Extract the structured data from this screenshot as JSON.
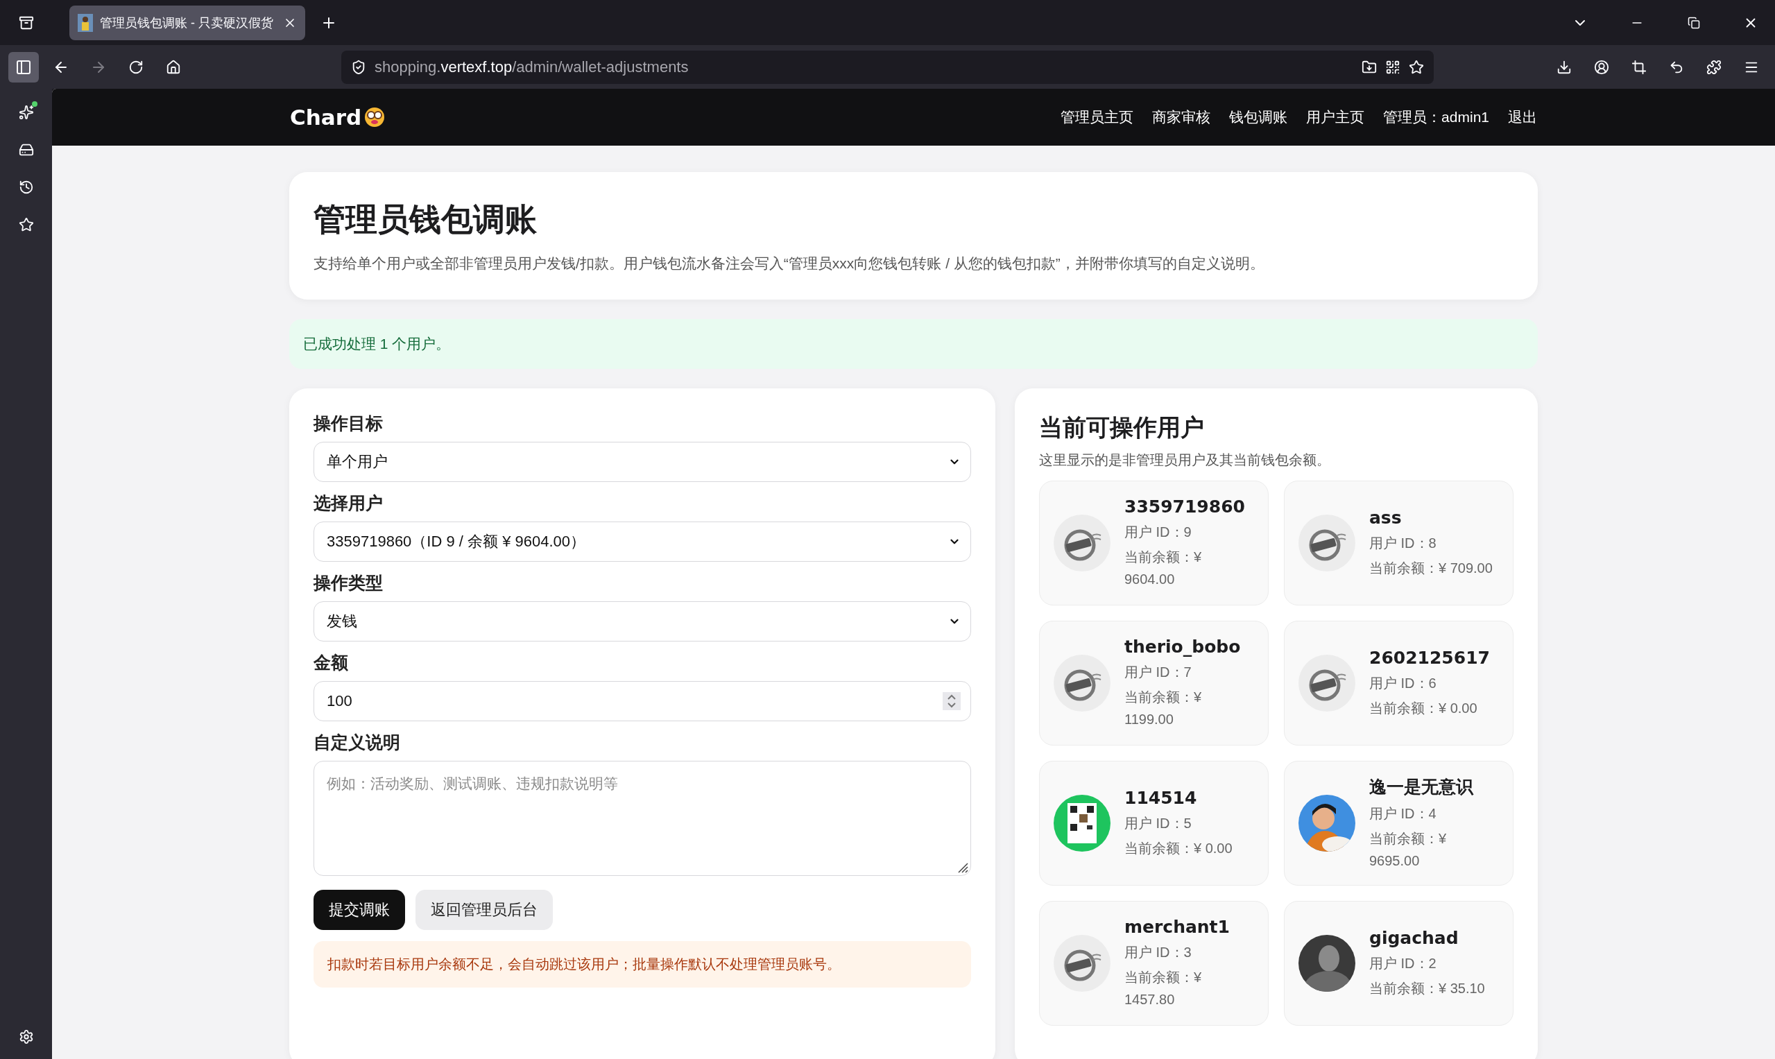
{
  "browser": {
    "tab_title": "管理员钱包调账 - 只卖硬汉假货",
    "url_host": "shopping.",
    "url_domain": "vertexf.top",
    "url_path": "/admin/wallet-adjustments"
  },
  "header": {
    "logo": "Chard",
    "nav": [
      "管理员主页",
      "商家审核",
      "钱包调账",
      "用户主页",
      "管理员：admin1",
      "退出"
    ]
  },
  "intro": {
    "title": "管理员钱包调账",
    "description": "支持给单个用户或全部非管理员用户发钱/扣款。用户钱包流水备注会写入“管理员xxx向您钱包转账 / 从您的钱包扣款”，并附带你填写的自定义说明。"
  },
  "success_message": "已成功处理 1 个用户。",
  "form": {
    "fields": [
      {
        "kind": "select",
        "label": "操作目标",
        "value": "单个用户"
      },
      {
        "kind": "select",
        "label": "选择用户",
        "value": "3359719860（ID 9 / 余额 ¥ 9604.00）"
      },
      {
        "kind": "select",
        "label": "操作类型",
        "value": "发钱"
      },
      {
        "kind": "number",
        "label": "金额",
        "value": "100"
      },
      {
        "kind": "textarea",
        "label": "自定义说明",
        "placeholder": "例如：活动奖励、测试调账、违规扣款说明等"
      }
    ],
    "buttons": [
      {
        "kind": "primary",
        "label": "提交调账"
      },
      {
        "kind": "secondary",
        "label": "返回管理员后台"
      }
    ],
    "notice": "扣款时若目标用户余额不足，会自动跳过该用户；批量操作默认不处理管理员账号。"
  },
  "users_panel": {
    "title": "当前可操作用户",
    "subtitle": "这里显示的是非管理员用户及其当前钱包余额。",
    "users": [
      {
        "name": "3359719860",
        "id": "用户 ID：9",
        "balance": "当前余额：¥ 9604.00"
      },
      {
        "name": "ass",
        "id": "用户 ID：8",
        "balance": "当前余额：¥ 709.00"
      },
      {
        "name": "therio_bobo",
        "id": "用户 ID：7",
        "balance": "当前余额：¥ 1199.00"
      },
      {
        "name": "2602125617",
        "id": "用户 ID：6",
        "balance": "当前余额：¥ 0.00"
      },
      {
        "name": "114514",
        "id": "用户 ID：5",
        "balance": "当前余额：¥ 0.00"
      },
      {
        "name": "逸一是无意识",
        "id": "用户 ID：4",
        "balance": "当前余额：¥ 9695.00"
      },
      {
        "name": "merchant1",
        "id": "用户 ID：3",
        "balance": "当前余额：¥ 1457.80"
      },
      {
        "name": "gigachad",
        "id": "用户 ID：2",
        "balance": "当前余额：¥ 35.10"
      }
    ]
  }
}
